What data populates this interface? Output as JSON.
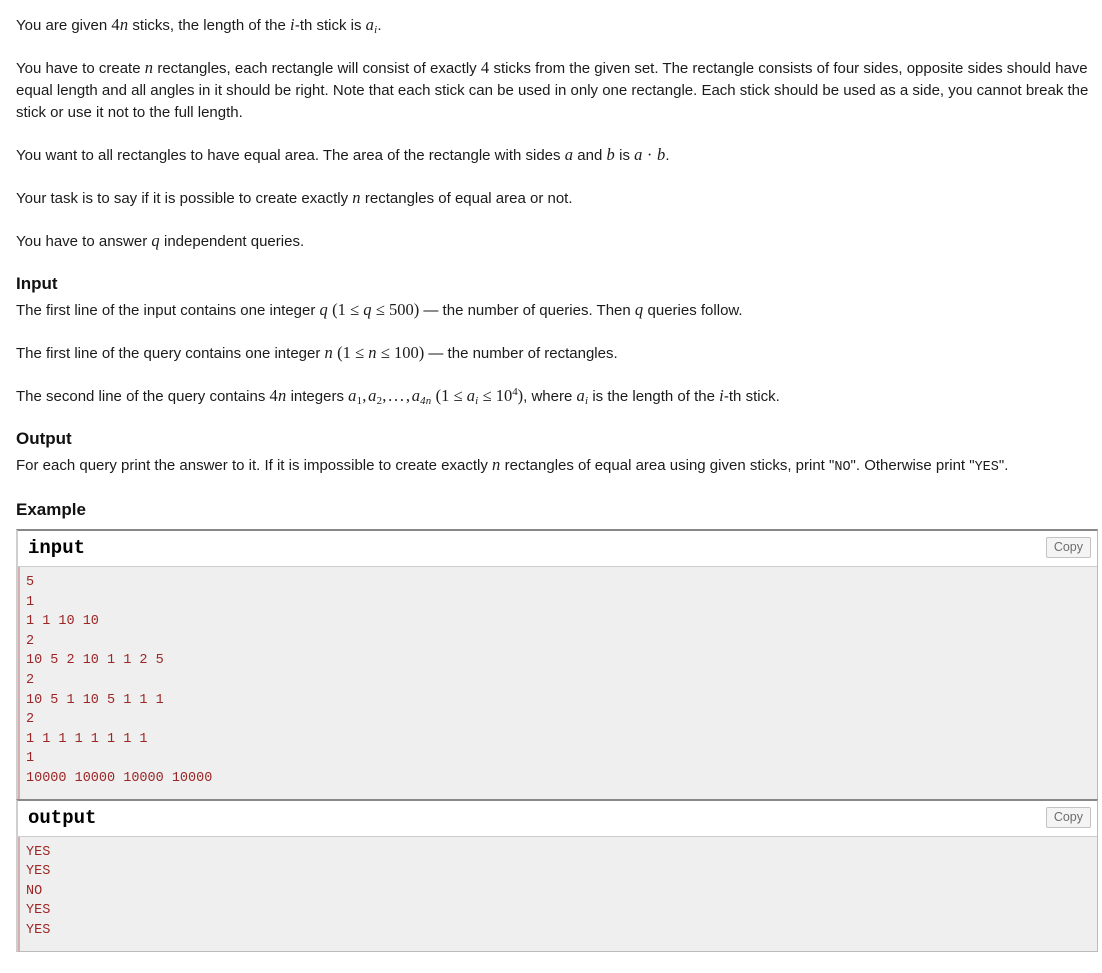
{
  "statement": {
    "paragraphs": [
      {
        "id": "p-sticks",
        "parts": [
          {
            "t": "text",
            "v": "You are given "
          },
          {
            "t": "math",
            "v": "4n"
          },
          {
            "t": "text",
            "v": " sticks, the length of the "
          },
          {
            "t": "math",
            "v": "i"
          },
          {
            "t": "text",
            "v": "-th stick is "
          },
          {
            "t": "math",
            "v": "a_i"
          },
          {
            "t": "text",
            "v": "."
          }
        ]
      },
      {
        "id": "p-rectangles",
        "parts": [
          {
            "t": "text",
            "v": "You have to create "
          },
          {
            "t": "math",
            "v": "n"
          },
          {
            "t": "text",
            "v": " rectangles, each rectangle will consist of exactly "
          },
          {
            "t": "math",
            "v": "4"
          },
          {
            "t": "text",
            "v": " sticks from the given set. The rectangle consists of four sides, opposite sides should have equal length and all angles in it should be right. Note that each stick can be used in only one rectangle. Each stick should be used as a side, you cannot break the stick or use it not to the full length."
          }
        ]
      },
      {
        "id": "p-area",
        "parts": [
          {
            "t": "text",
            "v": "You want to all rectangles to have equal area. The area of the rectangle with sides "
          },
          {
            "t": "math",
            "v": "a"
          },
          {
            "t": "text",
            "v": " and "
          },
          {
            "t": "math",
            "v": "b"
          },
          {
            "t": "text",
            "v": " is "
          },
          {
            "t": "math",
            "v": "a · b"
          },
          {
            "t": "text",
            "v": "."
          }
        ]
      },
      {
        "id": "p-task",
        "parts": [
          {
            "t": "text",
            "v": "Your task is to say if it is possible to create exactly "
          },
          {
            "t": "math",
            "v": "n"
          },
          {
            "t": "text",
            "v": " rectangles of equal area or not."
          }
        ]
      },
      {
        "id": "p-queries",
        "parts": [
          {
            "t": "text",
            "v": "You have to answer "
          },
          {
            "t": "math",
            "v": "q"
          },
          {
            "t": "text",
            "v": " independent queries."
          }
        ]
      }
    ]
  },
  "input_section": {
    "heading": "Input",
    "paragraphs": [
      "The first line of the input contains one integer q (1 ≤ q ≤ 500) — the number of queries. Then q queries follow.",
      "The first line of the query contains one integer n (1 ≤ n ≤ 100) — the number of rectangles.",
      "The second line of the query contains 4n integers a₁, a₂, …, a₄ₙ (1 ≤ aᵢ ≤ 10⁴), where aᵢ is the length of the i-th stick."
    ],
    "line1": {
      "before": "The first line of the input contains one integer ",
      "var": "q",
      "paren_open": "(",
      "lo": "1",
      "rel1": "≤",
      "mid": "q",
      "rel2": "≤",
      "hi": "500",
      "paren_close": ")",
      "after": " — the number of queries. Then ",
      "var2": "q",
      "tail": " queries follow."
    },
    "line2": {
      "before": "The first line of the query contains one integer ",
      "var": "n",
      "lo": "1",
      "mid": "n",
      "hi": "100",
      "after": " — the number of rectangles."
    },
    "line3": {
      "before": "The second line of the query contains ",
      "count": "4n",
      "mid1": " integers ",
      "lo": "1",
      "hi_base": "10",
      "hi_exp": "4",
      "mid2": ", where ",
      "tail": " is the length of the ",
      "tail2": "-th stick."
    }
  },
  "output_section": {
    "heading": "Output",
    "before": "For each query print the answer to it. If it is impossible to create exactly ",
    "var_n": "n",
    "middle": " rectangles of equal area using given sticks, print \"",
    "no_literal": "NO",
    "after_no": "\". Otherwise print \"",
    "yes_literal": "YES",
    "after_yes": "\"."
  },
  "example_section": {
    "heading": "Example",
    "copy_label": "Copy",
    "blocks": [
      {
        "title": "input",
        "copy_label": "Copy",
        "lines": [
          "5",
          "1",
          "1 1 10 10",
          "2",
          "10 5 2 10 1 1 2 5",
          "2",
          "10 5 1 10 5 1 1 1",
          "2",
          "1 1 1 1 1 1 1 1",
          "1",
          "10000 10000 10000 10000"
        ]
      },
      {
        "title": "output",
        "copy_label": "Copy",
        "lines": [
          "YES",
          "YES",
          "NO",
          "YES",
          "YES"
        ]
      }
    ]
  },
  "colors": {
    "text": "#1b1b1b",
    "sample_text": "#9c2626",
    "sample_bg": "#efefef",
    "box_border": "#bbbbbb",
    "box_top_border": "#888888",
    "copy_button_text": "#6d6d6d"
  }
}
